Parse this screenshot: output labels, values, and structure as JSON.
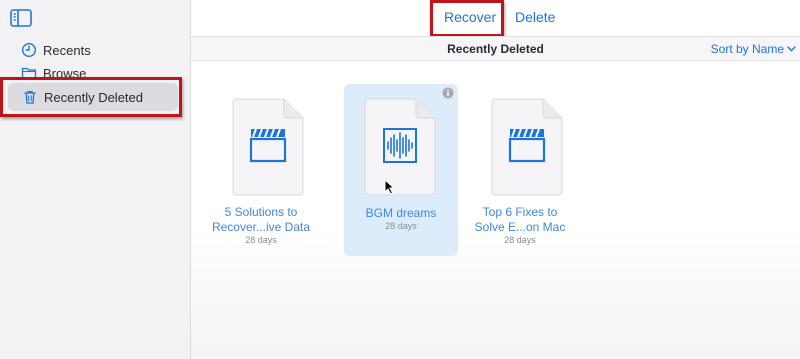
{
  "sidebar": {
    "items": [
      {
        "label": "Recents",
        "icon": "clock-icon"
      },
      {
        "label": "Browse",
        "icon": "folder-icon"
      },
      {
        "label": "Recently Deleted",
        "icon": "trash-icon",
        "selected": true
      }
    ]
  },
  "toolbar": {
    "recover_label": "Recover",
    "delete_label": "Delete"
  },
  "header": {
    "title": "Recently Deleted",
    "sort_label": "Sort by Name"
  },
  "files": [
    {
      "name_line1": "5 Solutions to",
      "name_line2": "Recover...ive Data",
      "age": "28 days",
      "type": "video",
      "icon": "video-clapper-icon"
    },
    {
      "name_line1": "BGM dreams",
      "name_line2": "",
      "age": "28 days",
      "type": "audio",
      "icon": "audio-waveform-icon",
      "selected": true
    },
    {
      "name_line1": "Top 6 Fixes to",
      "name_line2": "Solve E...on Mac",
      "age": "28 days",
      "type": "video",
      "icon": "video-clapper-icon"
    }
  ],
  "colors": {
    "accent": "#1f73e0",
    "annotation": "#c1141a",
    "selection": "#dcecfb"
  }
}
